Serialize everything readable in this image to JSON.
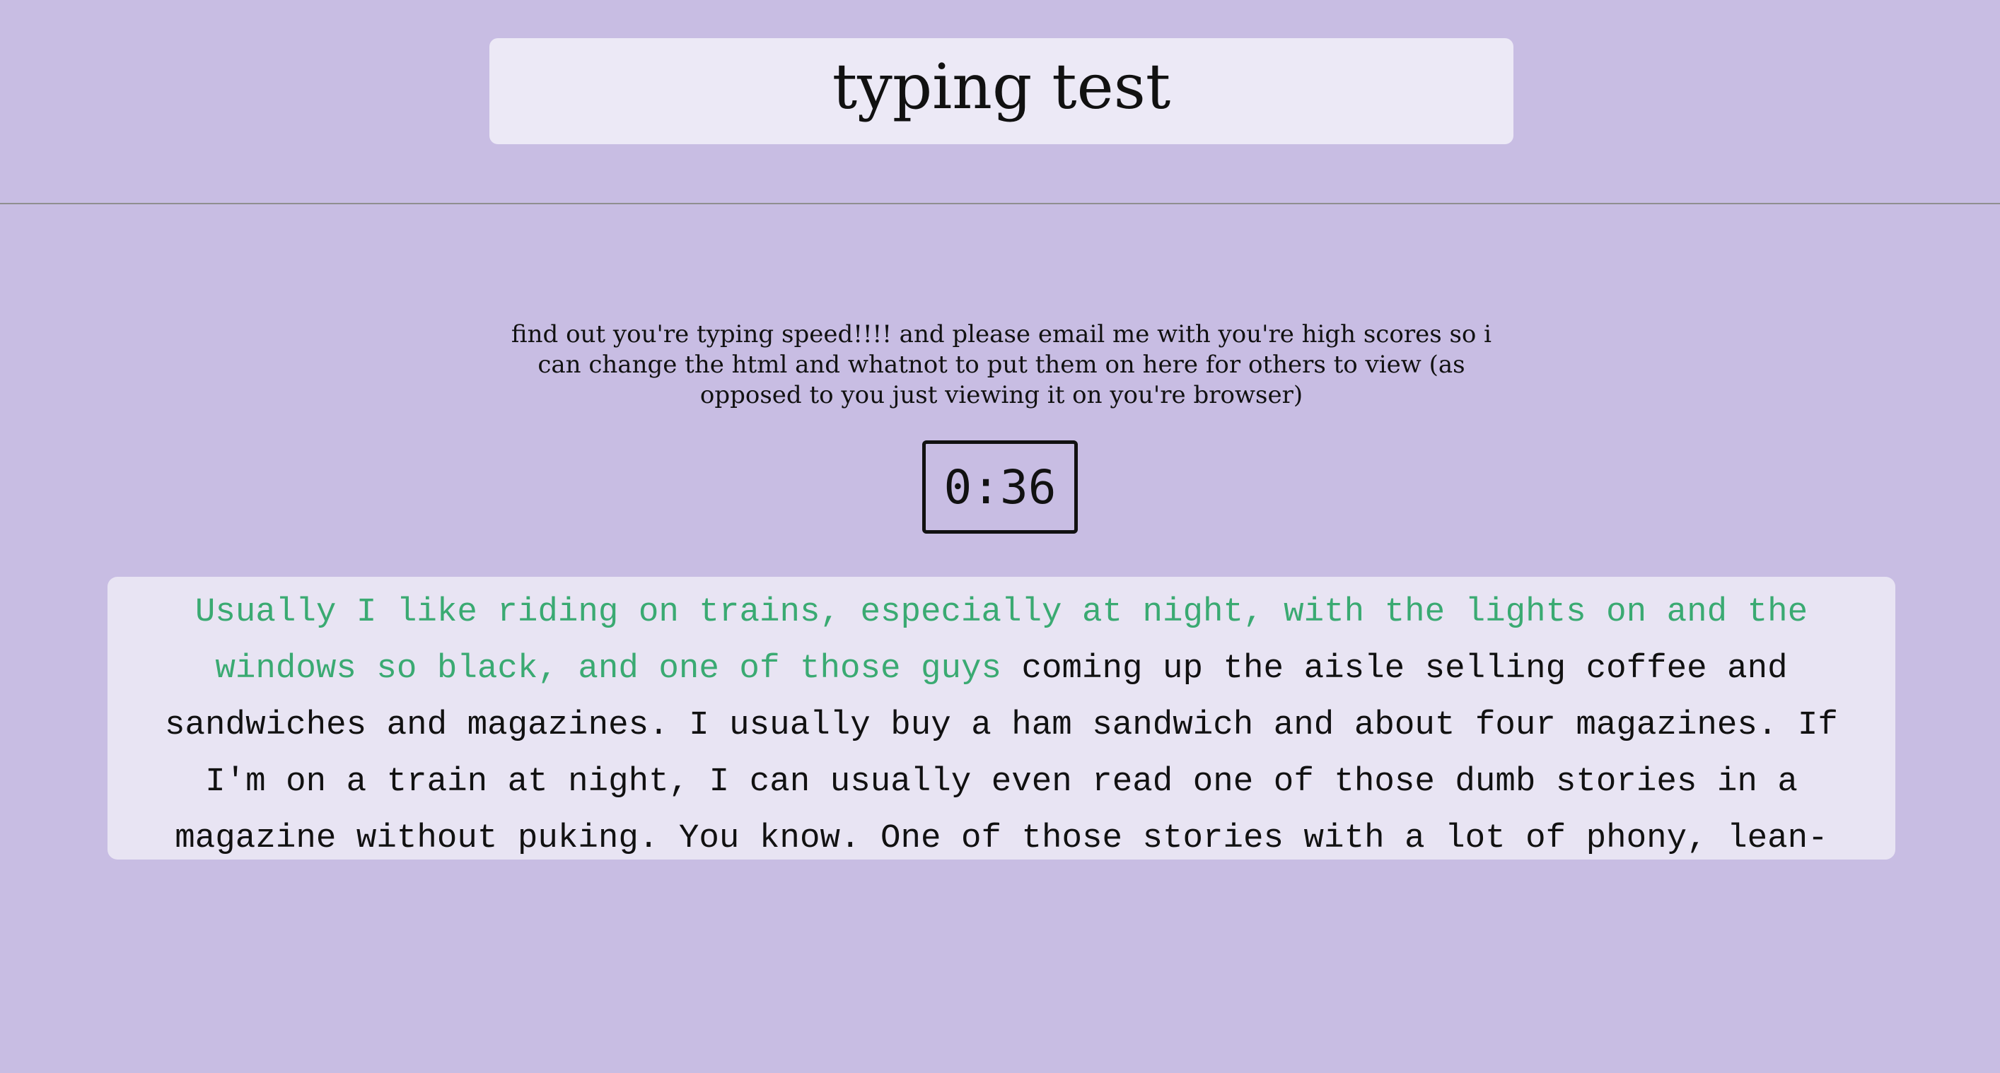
{
  "header": {
    "title": "typing test"
  },
  "intro": {
    "text": "find out you're typing speed!!!! and please email me with you're high scores so i can change the html and whatnot to put them on here for others to view (as opposed to you just viewing it on you're browser)"
  },
  "timer": {
    "value": "0:36"
  },
  "passage": {
    "typed": "Usually I like riding on trains, especially at night, with the lights on and the windows so black, and one of those guys",
    "remaining": " coming up the aisle selling coffee and sandwiches and magazines. I usually buy a ham sandwich and about four magazines. If I'm on a train at night, I can usually even read one of those dumb stories in a magazine without puking. You know. One of those stories with a lot of phony, lean-"
  },
  "colors": {
    "background": "#c8bde3",
    "panel": "#ece9f6",
    "typed_text": "#3aaa72",
    "text": "#111111"
  }
}
